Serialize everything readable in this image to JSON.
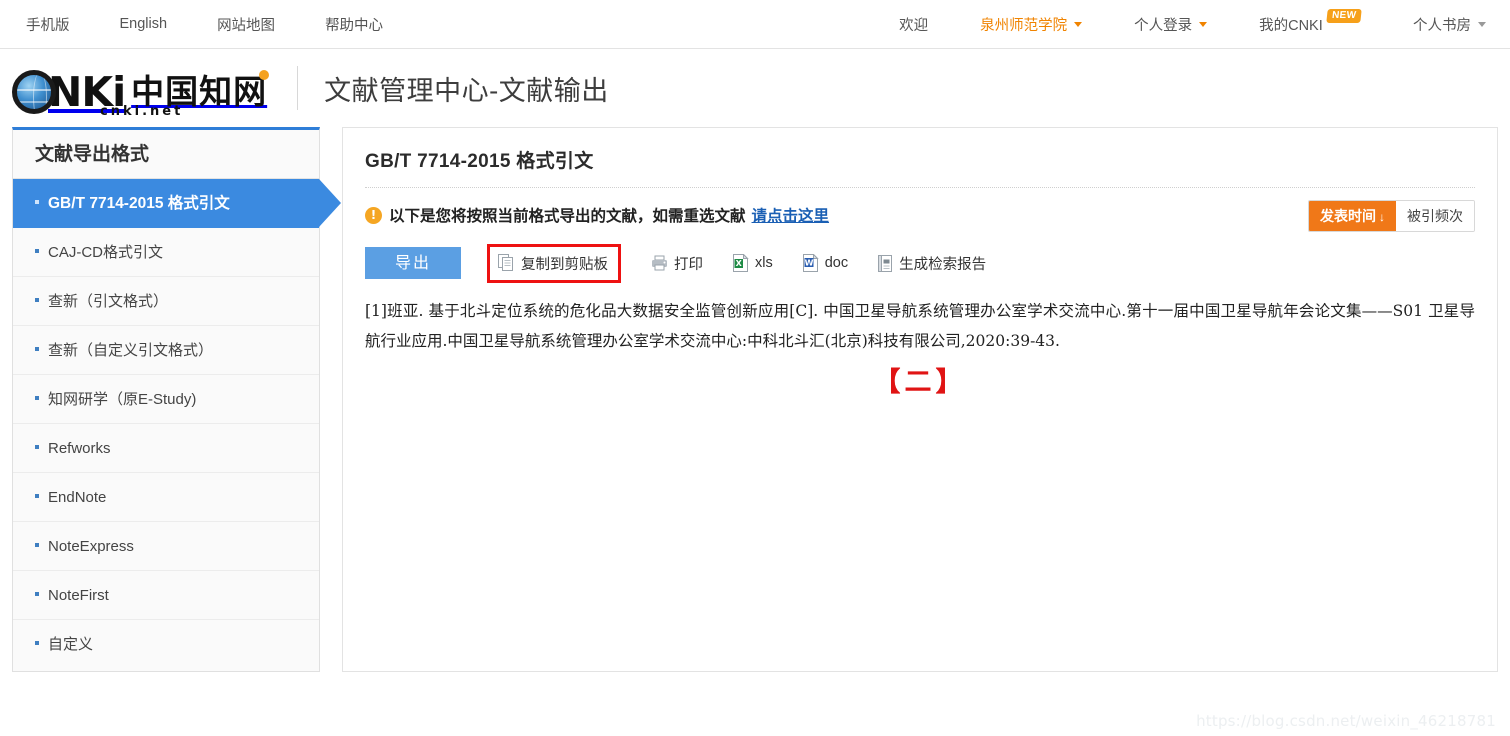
{
  "topbar": {
    "left_links": [
      {
        "label": "手机版",
        "name": "mobile-version"
      },
      {
        "label": "English",
        "name": "english"
      },
      {
        "label": "网站地图",
        "name": "site-map"
      },
      {
        "label": "帮助中心",
        "name": "help-center"
      }
    ],
    "welcome": "欢迎",
    "institution": "泉州师范学院",
    "personal_login": "个人登录",
    "my_cnki": "我的CNKI",
    "new_badge": "NEW",
    "personal_library": "个人书房"
  },
  "header": {
    "logo_mark": "NKi",
    "logo_cn": "中国知网",
    "logo_domain": "cnki.net",
    "title": "文献管理中心-文献输出"
  },
  "sidebar": {
    "title": "文献导出格式",
    "items": [
      {
        "label": "GB/T 7714-2015 格式引文",
        "active": true
      },
      {
        "label": "CAJ-CD格式引文",
        "active": false
      },
      {
        "label": "查新（引文格式）",
        "active": false
      },
      {
        "label": "查新（自定义引文格式）",
        "active": false
      },
      {
        "label": "知网研学（原E-Study)",
        "active": false
      },
      {
        "label": "Refworks",
        "active": false
      },
      {
        "label": "EndNote",
        "active": false
      },
      {
        "label": "NoteExpress",
        "active": false
      },
      {
        "label": "NoteFirst",
        "active": false
      },
      {
        "label": "自定义",
        "active": false
      }
    ]
  },
  "main": {
    "title": "GB/T 7714-2015 格式引文",
    "warn_glyph": "!",
    "notice_text": "以下是您将按照当前格式导出的文献，如需重选文献",
    "notice_link": "请点击这里",
    "sort": {
      "publish_time": "发表时间",
      "publish_time_arrow": "↓",
      "cited_count": "被引频次"
    },
    "toolbar": {
      "export": "导出",
      "copy_clipboard": "复制到剪贴板",
      "print": "打印",
      "xls": "xls",
      "doc": "doc",
      "report": "生成检索报告"
    },
    "citation": "[1]班亚. 基于北斗定位系统的危化品大数据安全监管创新应用[C]. 中国卫星导航系统管理办公室学术交流中心.第十一届中国卫星导航年会论文集——S01 卫星导航行业应用.中国卫星导航系统管理办公室学术交流中心:中科北斗汇(北京)科技有限公司,2020:39-43.",
    "annotation": "【二】"
  },
  "watermark": "https://blog.csdn.net/weixin_46218781",
  "colors": {
    "brand_blue": "#3b8ae0",
    "accent_orange": "#f07818",
    "link_blue": "#1a5fb4",
    "highlight_red": "#ee1111",
    "button_blue": "#5b9fe3"
  }
}
